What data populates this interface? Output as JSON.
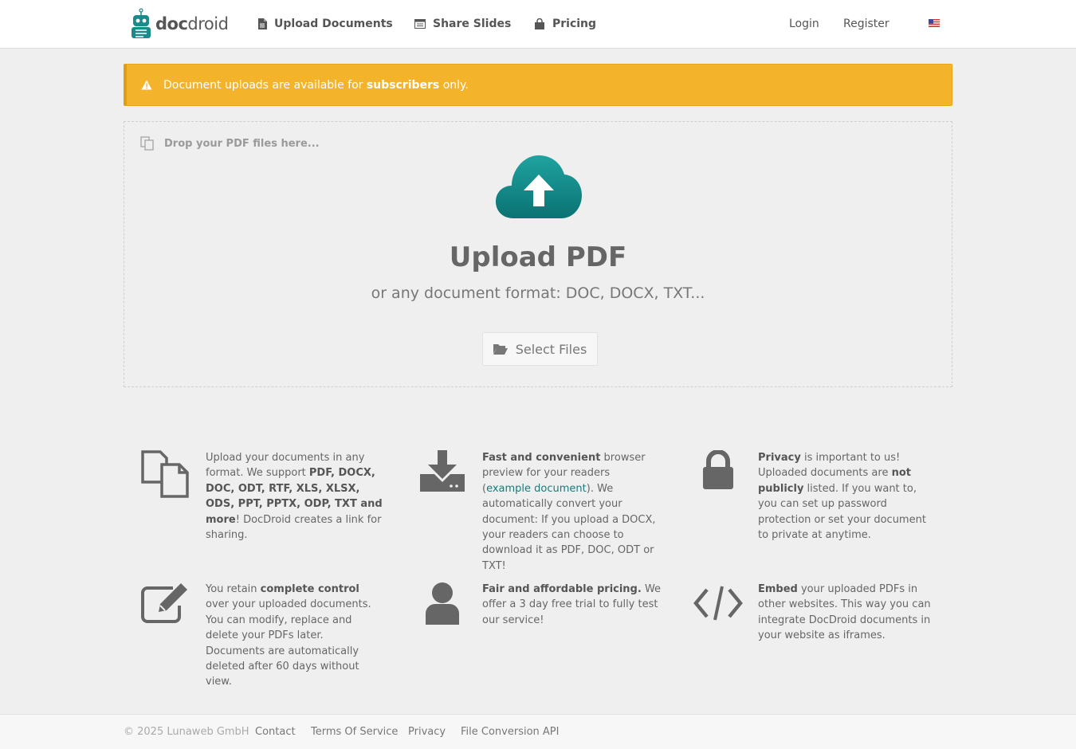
{
  "nav": {
    "logo_doc": "doc",
    "logo_droid": "droid",
    "upload": "Upload Documents",
    "share": "Share Slides",
    "pricing": "Pricing",
    "login": "Login",
    "register": "Register",
    "language_flag": "us-flag"
  },
  "alert": {
    "pre": "Document uploads are available for ",
    "strong": "subscribers",
    "post": " only.",
    "color": "#f3b32b"
  },
  "dropzone": {
    "hint": "Drop your PDF files here...",
    "title": "Upload PDF",
    "subtitle": "or any document format: DOC, DOCX, TXT...",
    "button": "Select Files",
    "accent": "#1a8a8a"
  },
  "features": [
    {
      "icon": "files-icon",
      "parts": [
        {
          "t": "Upload your documents in any format. We support "
        },
        {
          "b": "PDF, DOCX, DOC, ODT, RTF, XLS, XLSX, ODS, PPT, PPTX, ODP, TXT and more"
        },
        {
          "t": "! DocDroid creates a link for sharing."
        }
      ]
    },
    {
      "icon": "download-icon",
      "parts": [
        {
          "b": "Fast and convenient"
        },
        {
          "t": " browser preview for your readers ("
        },
        {
          "a": "example document"
        },
        {
          "t": "). We automatically convert your document: If you upload a DOCX, your readers can choose to download it as PDF, DOC, ODT or TXT!"
        }
      ]
    },
    {
      "icon": "lock-icon",
      "parts": [
        {
          "b": "Privacy"
        },
        {
          "t": " is important to us! Uploaded documents are "
        },
        {
          "b": "not publicly"
        },
        {
          "t": " listed. If you want to, you can set up password protection or set your document to private at anytime."
        }
      ]
    },
    {
      "icon": "edit-icon",
      "parts": [
        {
          "t": "You retain "
        },
        {
          "b": "complete control"
        },
        {
          "t": " over your uploaded documents. You can modify, replace and delete your PDFs later. Documents are automatically deleted after 60 days without view."
        }
      ]
    },
    {
      "icon": "user-icon",
      "parts": [
        {
          "b": "Fair and affordable pricing."
        },
        {
          "t": " We offer a 3 day free trial to fully test our service!"
        }
      ]
    },
    {
      "icon": "code-icon",
      "parts": [
        {
          "b": "Embed"
        },
        {
          "t": " your uploaded PDFs in other websites. This way you can integrate DocDroid documents in your website as iframes."
        }
      ]
    }
  ],
  "footer": {
    "copyright": "© 2025 Lunaweb GmbH",
    "contact": "Contact",
    "terms": "Terms Of Service",
    "privacy": "Privacy",
    "api": "File Conversion API"
  }
}
